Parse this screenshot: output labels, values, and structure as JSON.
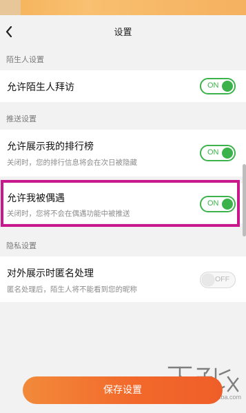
{
  "header": {
    "title": "设置",
    "back_icon": "chevron-left-icon"
  },
  "sections": [
    {
      "label": "陌生人设置",
      "items": [
        {
          "title": "允许陌生人拜访",
          "description": "",
          "toggle": "ON",
          "enabled": true
        }
      ]
    },
    {
      "label": "推送设置",
      "items": [
        {
          "title": "允许展示我的排行榜",
          "description": "关闭时，您的排行信息将会在次日被隐藏",
          "toggle": "ON",
          "enabled": true
        },
        {
          "title": "允许我被偶遇",
          "description": "关闭时，您将不会在偶遇功能中被推送",
          "toggle": "ON",
          "enabled": true
        }
      ]
    },
    {
      "label": "隐私设置",
      "items": [
        {
          "title": "对外展示时匿名处理",
          "description": "匿名处理后，陌生人将不能看到您的昵称",
          "toggle": "OFF",
          "enabled": false
        }
      ]
    }
  ],
  "footer": {
    "save_label": "保存设置"
  },
  "watermark": {
    "text": "www.xiazaiba.com"
  },
  "colors": {
    "toggle_on": "#3bb34a",
    "highlight": "#c8188b",
    "save_button": "#f2692b"
  }
}
